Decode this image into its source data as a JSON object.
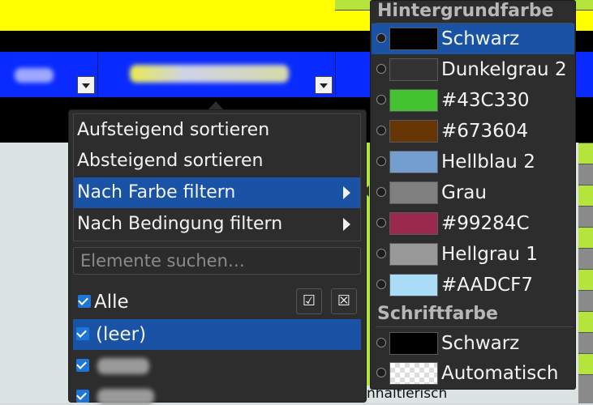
{
  "filter_menu": {
    "items": [
      {
        "label": "Aufsteigend sortieren"
      },
      {
        "label": "Absteigend sortieren"
      },
      {
        "label": "Nach Farbe filtern"
      },
      {
        "label": "Nach Bedingung filtern"
      }
    ],
    "search_placeholder": "Elemente suchen…",
    "all_label": "Alle",
    "check_all_icon": "check-all-icon",
    "uncheck_all_icon": "uncheck-all-icon",
    "list_items": [
      {
        "label": "(leer)",
        "checked": true,
        "selected": true
      },
      {
        "label": "",
        "checked": true,
        "selected": false
      },
      {
        "label": "",
        "checked": true,
        "selected": false
      }
    ]
  },
  "color_submenu": {
    "background_header": "Hintergrundfarbe",
    "background_colors": [
      {
        "label": "Schwarz",
        "color": "#000000",
        "selected": true
      },
      {
        "label": "Dunkelgrau 2",
        "color": "#333333",
        "selected": false
      },
      {
        "label": "#43C330",
        "color": "#43C330",
        "selected": false
      },
      {
        "label": "#673604",
        "color": "#673604",
        "selected": false
      },
      {
        "label": "Hellblau 2",
        "color": "#729FCF",
        "selected": false
      },
      {
        "label": "Grau",
        "color": "#808080",
        "selected": false
      },
      {
        "label": "#99284C",
        "color": "#99284C",
        "selected": false
      },
      {
        "label": "Hellgrau 1",
        "color": "#999999",
        "selected": false
      },
      {
        "label": "#AADCF7",
        "color": "#AADCF7",
        "selected": false
      }
    ],
    "font_header": "Schriftfarbe",
    "font_colors": [
      {
        "label": "Schwarz",
        "color": "#000000"
      },
      {
        "label": "Automatisch",
        "color": "auto"
      }
    ]
  },
  "sheet": {
    "partial_cell_text": "nhaltlerisch"
  },
  "colors": {
    "accent": "#1a53a6",
    "menu_bg": "#2d2d2d",
    "header_blue": "#0a2bff",
    "yellow": "#ffff00",
    "green": "#b5e53c"
  }
}
